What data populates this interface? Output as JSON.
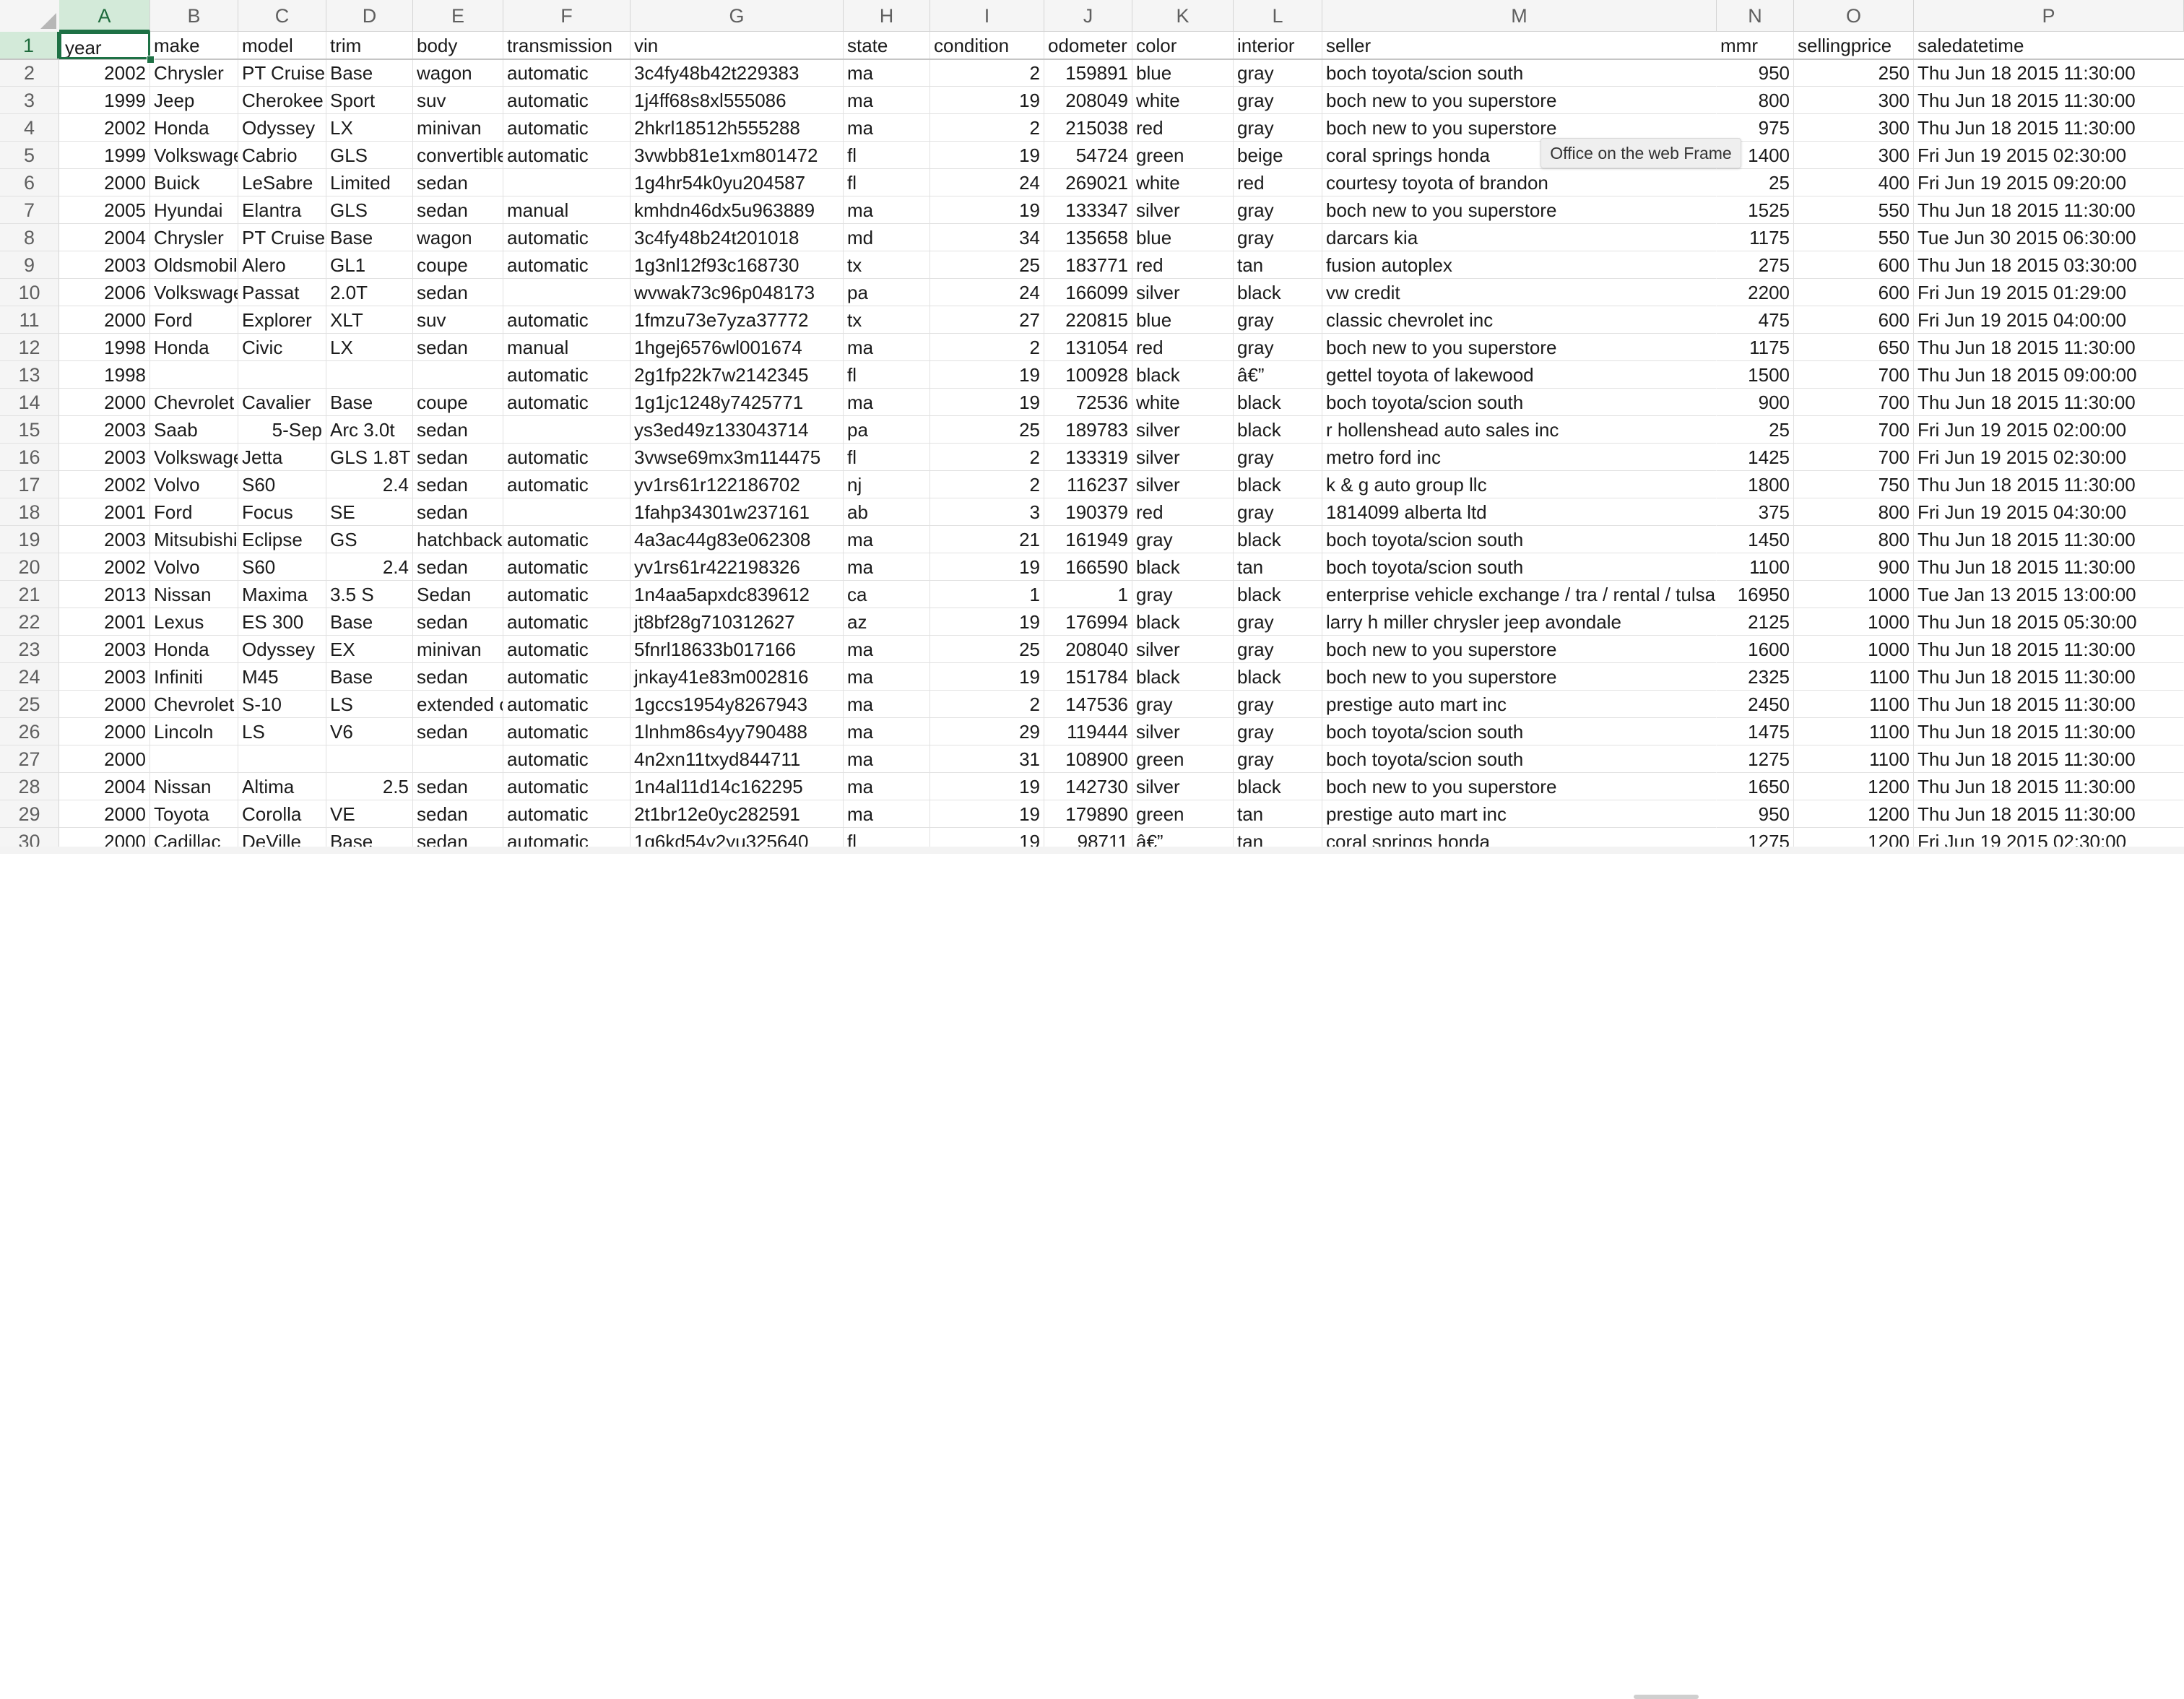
{
  "sheet": {
    "columns": [
      "A",
      "B",
      "C",
      "D",
      "E",
      "F",
      "G",
      "H",
      "I",
      "J",
      "K",
      "L",
      "M",
      "N",
      "O",
      "P"
    ],
    "selected_column": "A",
    "selected_row": "1",
    "active_cell": "A1",
    "fields": [
      "year",
      "make",
      "model",
      "trim",
      "body",
      "transmission",
      "vin",
      "state",
      "condition",
      "odometer",
      "color",
      "interior",
      "seller",
      "mmr",
      "sellingprice",
      "saledatetime"
    ],
    "row_numbers": [
      "1",
      "2",
      "3",
      "4",
      "5",
      "6",
      "7",
      "8",
      "9",
      "10",
      "11",
      "12",
      "13",
      "14",
      "15",
      "16",
      "17",
      "18",
      "19",
      "20",
      "21",
      "22",
      "23",
      "24",
      "25",
      "26",
      "27",
      "28",
      "29",
      "30"
    ],
    "rows": [
      [
        "2002",
        "Chrysler",
        "PT Cruiser",
        "Base",
        "wagon",
        "automatic",
        "3c4fy48b42t229383",
        "ma",
        "2",
        "159891",
        "blue",
        "gray",
        "boch toyota/scion south",
        "950",
        "250",
        "Thu Jun 18 2015 11:30:00"
      ],
      [
        "1999",
        "Jeep",
        "Cherokee",
        "Sport",
        "suv",
        "automatic",
        "1j4ff68s8xl555086",
        "ma",
        "19",
        "208049",
        "white",
        "gray",
        "boch new to you superstore",
        "800",
        "300",
        "Thu Jun 18 2015 11:30:00"
      ],
      [
        "2002",
        "Honda",
        "Odyssey",
        "LX",
        "minivan",
        "automatic",
        "2hkrl18512h555288",
        "ma",
        "2",
        "215038",
        "red",
        "gray",
        "boch new to you superstore",
        "975",
        "300",
        "Thu Jun 18 2015 11:30:00"
      ],
      [
        "1999",
        "Volkswagen",
        "Cabrio",
        "GLS",
        "convertible",
        "automatic",
        "3vwbb81e1xm801472",
        "fl",
        "19",
        "54724",
        "green",
        "beige",
        "coral springs honda",
        "1400",
        "300",
        "Fri Jun 19 2015 02:30:00"
      ],
      [
        "2000",
        "Buick",
        "LeSabre",
        "Limited",
        "sedan",
        "",
        "1g4hr54k0yu204587",
        "fl",
        "24",
        "269021",
        "white",
        "red",
        "courtesy toyota of brandon",
        "25",
        "400",
        "Fri Jun 19 2015 09:20:00"
      ],
      [
        "2005",
        "Hyundai",
        "Elantra",
        "GLS",
        "sedan",
        "manual",
        "kmhdn46dx5u963889",
        "ma",
        "19",
        "133347",
        "silver",
        "gray",
        "boch new to you superstore",
        "1525",
        "550",
        "Thu Jun 18 2015 11:30:00"
      ],
      [
        "2004",
        "Chrysler",
        "PT Cruiser",
        "Base",
        "wagon",
        "automatic",
        "3c4fy48b24t201018",
        "md",
        "34",
        "135658",
        "blue",
        "gray",
        "darcars kia",
        "1175",
        "550",
        "Tue Jun 30 2015 06:30:00"
      ],
      [
        "2003",
        "Oldsmobile",
        "Alero",
        "GL1",
        "coupe",
        "automatic",
        "1g3nl12f93c168730",
        "tx",
        "25",
        "183771",
        "red",
        "tan",
        "fusion autoplex",
        "275",
        "600",
        "Thu Jun 18 2015 03:30:00"
      ],
      [
        "2006",
        "Volkswagen",
        "Passat",
        "2.0T",
        "sedan",
        "",
        "wvwak73c96p048173",
        "pa",
        "24",
        "166099",
        "silver",
        "black",
        "vw credit",
        "2200",
        "600",
        "Fri Jun 19 2015 01:29:00"
      ],
      [
        "2000",
        "Ford",
        "Explorer",
        "XLT",
        "suv",
        "automatic",
        "1fmzu73e7yza37772",
        "tx",
        "27",
        "220815",
        "blue",
        "gray",
        "classic chevrolet inc",
        "475",
        "600",
        "Fri Jun 19 2015 04:00:00"
      ],
      [
        "1998",
        "Honda",
        "Civic",
        "LX",
        "sedan",
        "manual",
        "1hgej6576wl001674",
        "ma",
        "2",
        "131054",
        "red",
        "gray",
        "boch new to you superstore",
        "1175",
        "650",
        "Thu Jun 18 2015 11:30:00"
      ],
      [
        "1998",
        "",
        "",
        "",
        "",
        "automatic",
        "2g1fp22k7w2142345",
        "fl",
        "19",
        "100928",
        "black",
        "â€”",
        "gettel toyota of lakewood",
        "1500",
        "700",
        "Thu Jun 18 2015 09:00:00"
      ],
      [
        "2000",
        "Chevrolet",
        "Cavalier",
        "Base",
        "coupe",
        "automatic",
        "1g1jc1248y7425771",
        "ma",
        "19",
        "72536",
        "white",
        "black",
        "boch toyota/scion south",
        "900",
        "700",
        "Thu Jun 18 2015 11:30:00"
      ],
      [
        "2003",
        "Saab",
        "5-Sep",
        "Arc 3.0t",
        "sedan",
        "",
        "ys3ed49z133043714",
        "pa",
        "25",
        "189783",
        "silver",
        "black",
        "r hollenshead auto sales inc",
        "25",
        "700",
        "Fri Jun 19 2015 02:00:00"
      ],
      [
        "2003",
        "Volkswagen",
        "Jetta",
        "GLS 1.8T",
        "sedan",
        "automatic",
        "3vwse69mx3m114475",
        "fl",
        "2",
        "133319",
        "silver",
        "gray",
        "metro ford inc",
        "1425",
        "700",
        "Fri Jun 19 2015 02:30:00"
      ],
      [
        "2002",
        "Volvo",
        "S60",
        "2.4",
        "sedan",
        "automatic",
        "yv1rs61r122186702",
        "nj",
        "2",
        "116237",
        "silver",
        "black",
        "k & g auto group llc",
        "1800",
        "750",
        "Thu Jun 18 2015 11:30:00"
      ],
      [
        "2001",
        "Ford",
        "Focus",
        "SE",
        "sedan",
        "",
        "1fahp34301w237161",
        "ab",
        "3",
        "190379",
        "red",
        "gray",
        "1814099 alberta ltd",
        "375",
        "800",
        "Fri Jun 19 2015 04:30:00"
      ],
      [
        "2003",
        "Mitsubishi",
        "Eclipse",
        "GS",
        "hatchback",
        "automatic",
        "4a3ac44g83e062308",
        "ma",
        "21",
        "161949",
        "gray",
        "black",
        "boch toyota/scion south",
        "1450",
        "800",
        "Thu Jun 18 2015 11:30:00"
      ],
      [
        "2002",
        "Volvo",
        "S60",
        "2.4",
        "sedan",
        "automatic",
        "yv1rs61r422198326",
        "ma",
        "19",
        "166590",
        "black",
        "tan",
        "boch toyota/scion south",
        "1100",
        "900",
        "Thu Jun 18 2015 11:30:00"
      ],
      [
        "2013",
        "Nissan",
        "Maxima",
        "3.5 S",
        "Sedan",
        "automatic",
        "1n4aa5apxdc839612",
        "ca",
        "1",
        "1",
        "gray",
        "black",
        "enterprise vehicle exchange / tra / rental / tulsa",
        "16950",
        "1000",
        "Tue Jan 13 2015 13:00:00"
      ],
      [
        "2001",
        "Lexus",
        "ES 300",
        "Base",
        "sedan",
        "automatic",
        "jt8bf28g710312627",
        "az",
        "19",
        "176994",
        "black",
        "gray",
        "larry h miller chrysler jeep avondale",
        "2125",
        "1000",
        "Thu Jun 18 2015 05:30:00"
      ],
      [
        "2003",
        "Honda",
        "Odyssey",
        "EX",
        "minivan",
        "automatic",
        "5fnrl18633b017166",
        "ma",
        "25",
        "208040",
        "silver",
        "gray",
        "boch new to you superstore",
        "1600",
        "1000",
        "Thu Jun 18 2015 11:30:00"
      ],
      [
        "2003",
        "Infiniti",
        "M45",
        "Base",
        "sedan",
        "automatic",
        "jnkay41e83m002816",
        "ma",
        "19",
        "151784",
        "black",
        "black",
        "boch new to you superstore",
        "2325",
        "1100",
        "Thu Jun 18 2015 11:30:00"
      ],
      [
        "2000",
        "Chevrolet",
        "S-10",
        "LS",
        "extended cab",
        "automatic",
        "1gccs1954y8267943",
        "ma",
        "2",
        "147536",
        "gray",
        "gray",
        "prestige auto mart inc",
        "2450",
        "1100",
        "Thu Jun 18 2015 11:30:00"
      ],
      [
        "2000",
        "Lincoln",
        "LS",
        "V6",
        "sedan",
        "automatic",
        "1lnhm86s4yy790488",
        "ma",
        "29",
        "119444",
        "silver",
        "gray",
        "boch toyota/scion south",
        "1475",
        "1100",
        "Thu Jun 18 2015 11:30:00"
      ],
      [
        "2000",
        "",
        "",
        "",
        "",
        "automatic",
        "4n2xn11txyd844711",
        "ma",
        "31",
        "108900",
        "green",
        "gray",
        "boch toyota/scion south",
        "1275",
        "1100",
        "Thu Jun 18 2015 11:30:00"
      ],
      [
        "2004",
        "Nissan",
        "Altima",
        "2.5",
        "sedan",
        "automatic",
        "1n4al11d14c162295",
        "ma",
        "19",
        "142730",
        "silver",
        "black",
        "boch new to you superstore",
        "1650",
        "1200",
        "Thu Jun 18 2015 11:30:00"
      ],
      [
        "2000",
        "Toyota",
        "Corolla",
        "VE",
        "sedan",
        "automatic",
        "2t1br12e0yc282591",
        "ma",
        "19",
        "179890",
        "green",
        "tan",
        "prestige auto mart inc",
        "950",
        "1200",
        "Thu Jun 18 2015 11:30:00"
      ],
      [
        "2000",
        "Cadillac",
        "DeVille",
        "Base",
        "sedan",
        "automatic",
        "1g6kd54y2yu325640",
        "fl",
        "19",
        "98711",
        "â€”",
        "tan",
        "coral springs honda",
        "1275",
        "1200",
        "Fri Jun 19 2015 02:30:00"
      ]
    ]
  },
  "tooltip": {
    "text": "Office on the web Frame"
  },
  "colors": {
    "accent": "#1e7145",
    "header_bg": "#f5f5f5",
    "selected_header_bg": "#d3ead9",
    "gridline": "#e1e1e1"
  }
}
